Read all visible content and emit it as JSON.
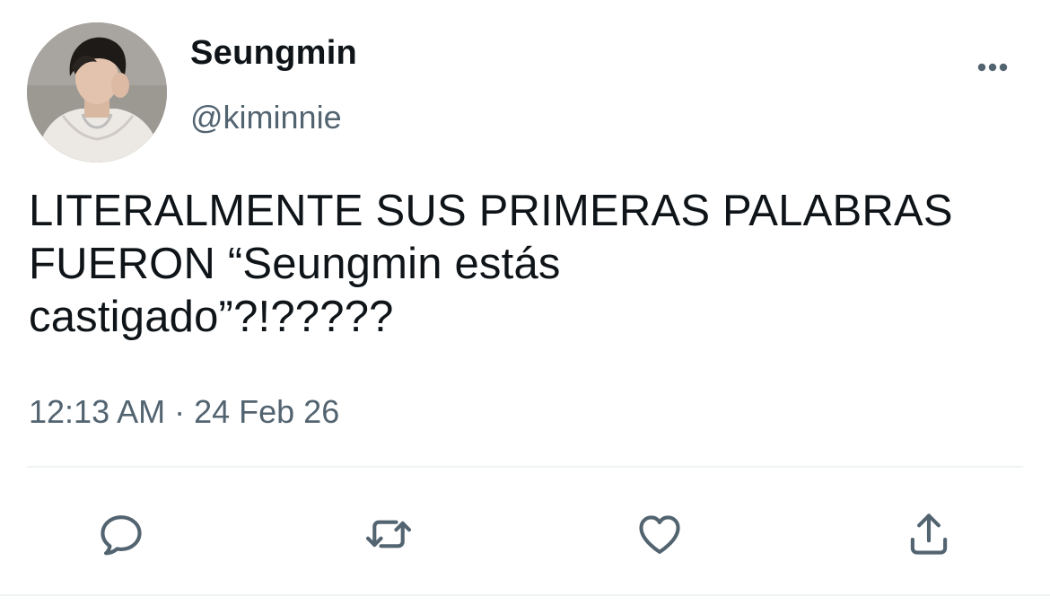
{
  "author": {
    "display_name": "Seungmin",
    "handle": "@kiminnie",
    "avatar_icon": "profile-photo"
  },
  "tweet": {
    "text": "LITERALMENTE SUS PRIMERAS PALABRAS\nFUERON “Seungmin estás\ncastigado”?!?????",
    "timestamp": "12:13 AM · 24 Feb 26"
  },
  "actions": {
    "reply_icon": "reply-icon",
    "retweet_icon": "retweet-icon",
    "like_icon": "heart-icon",
    "share_icon": "share-icon",
    "more_icon": "more-icon"
  },
  "colors": {
    "text": "#0f1419",
    "secondary": "#536471",
    "divider": "#eff3f4"
  }
}
